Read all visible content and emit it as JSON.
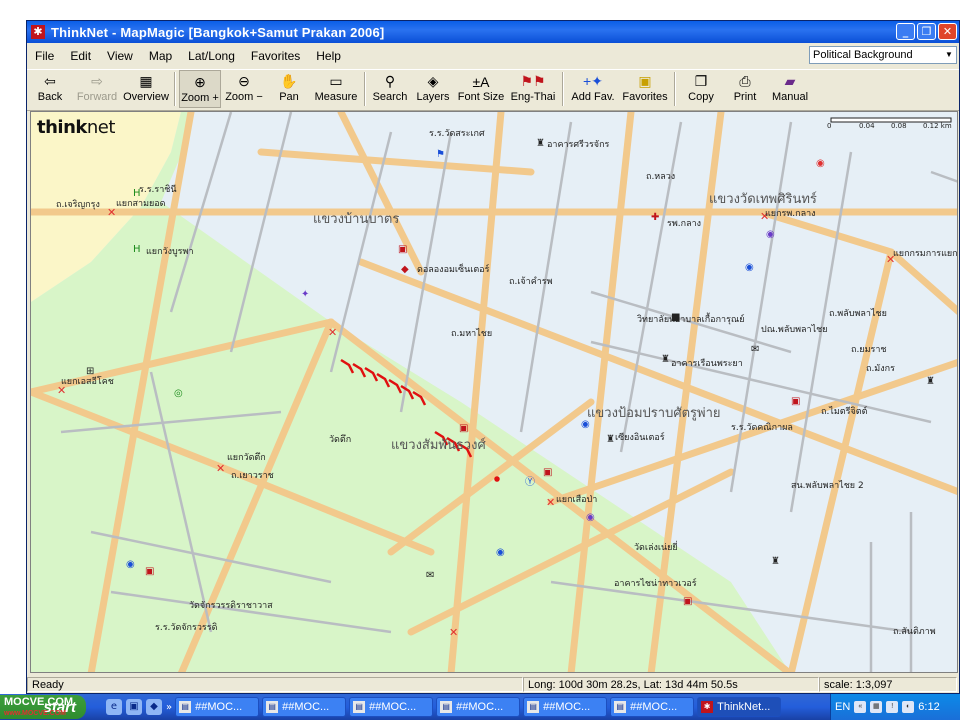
{
  "window": {
    "title": "ThinkNet - MapMagic [Bangkok+Samut Prakan 2006]",
    "icon": "thinknet-app-icon",
    "controls": [
      "minimize",
      "maximize",
      "close"
    ]
  },
  "menu": [
    "File",
    "Edit",
    "View",
    "Map",
    "Lat/Long",
    "Favorites",
    "Help"
  ],
  "layer_select": {
    "value": "Political Background"
  },
  "toolbar": [
    {
      "label": "Back",
      "icon": "back-arrow-icon",
      "enabled": true
    },
    {
      "label": "Forward",
      "icon": "forward-arrow-icon",
      "enabled": false
    },
    {
      "label": "Overview",
      "icon": "overview-icon",
      "enabled": true
    },
    {
      "label": "Zoom +",
      "icon": "zoom-in-icon",
      "enabled": true,
      "pressed": true
    },
    {
      "label": "Zoom −",
      "icon": "zoom-out-icon",
      "enabled": true
    },
    {
      "label": "Pan",
      "icon": "hand-icon",
      "enabled": true
    },
    {
      "label": "Measure",
      "icon": "ruler-icon",
      "enabled": true
    },
    {
      "label": "Search",
      "icon": "binoculars-icon",
      "enabled": true
    },
    {
      "label": "Layers",
      "icon": "layers-icon",
      "enabled": true
    },
    {
      "label": "Font Size",
      "icon": "font-size-icon",
      "enabled": true
    },
    {
      "label": "Eng-Thai",
      "icon": "flags-icon",
      "enabled": true
    },
    {
      "label": "Add Fav.",
      "icon": "add-favorite-icon",
      "enabled": true
    },
    {
      "label": "Favorites",
      "icon": "favorites-icon",
      "enabled": true
    },
    {
      "label": "Copy",
      "icon": "copy-icon",
      "enabled": true
    },
    {
      "label": "Print",
      "icon": "printer-icon",
      "enabled": true
    },
    {
      "label": "Manual",
      "icon": "book-icon",
      "enabled": true
    }
  ],
  "map": {
    "logo": {
      "think": "think",
      "net": "net"
    },
    "scale_ticks": [
      "0",
      "0.04",
      "0.08",
      "0.12 km"
    ],
    "labels": [
      "แขวงบ้านบาตร",
      "แขวงวัดเทพศิรินทร์",
      "แขวงป้อมปราบศัตรูพ่าย",
      "แขวงสัมพันธวงศ์",
      "ถ.เจริญกรุง",
      "ถ.หลวง",
      "ถ.เจ้าคำรพ",
      "ถ.มหาไชย",
      "ถ.ยมราช",
      "ถ.เยาวราช",
      "ถ.มังกร",
      "ถ.สันติภาพ",
      "ถ.ไมตรีจิตต์",
      "ถ.พลับพลาไชย",
      "แยกสามยอด",
      "แยกวังบูรพา",
      "แยกเอสอีโคช",
      "แยกวัดตึก",
      "แยกเสือป่า",
      "แยกกรมการแยกพลับ",
      "วิทยาลัยพยาบาลเกื้อการุณย์",
      "วัดตึก",
      "วัดเล่งเน่ยยี่",
      "วัดจักรวรรดิราชาวาส",
      "อาคารศรีวรจักร",
      "อาคารเรือนพระยา",
      "อาคารไชน่าทาวเวอร์",
      "ดอลองอมเซ็นเตอร์",
      "ปณ.พลับพลาไชย",
      "ร.ร.วัดคณิกาผล",
      "รพ.กลาง",
      "สน.พลับพลาไชย 2",
      "ร.ร.วัดจักรวรรดิ",
      "ร.ร.วัดสระเกศ",
      "เซียงอินเตอร์",
      "ร.ร.ราชินี",
      "แยกรพ.กลาง"
    ]
  },
  "status": {
    "ready": "Ready",
    "coords": "Long: 100d 30m 28.2s, Lat: 13d  44m 50.5s",
    "scale": "scale: 1:3,097"
  },
  "taskbar": {
    "start": "start",
    "watermark": {
      "line1": "MOCVE.COM",
      "line2": "www.MOCVE.COM"
    },
    "tasks": [
      "##MOC...",
      "##MOC...",
      "##MOC...",
      "##MOC...",
      "##MOC...",
      "##MOC...",
      "ThinkNet..."
    ],
    "lang": "EN",
    "clock": "6:12"
  }
}
